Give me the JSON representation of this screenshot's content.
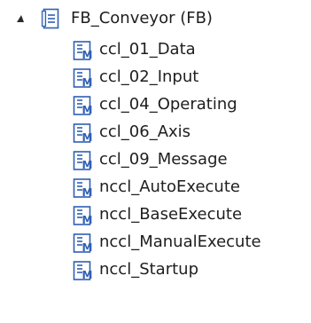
{
  "tree": {
    "root": {
      "label": "FB_Conveyor (FB)",
      "expanded": true,
      "icon": "function-block-icon"
    },
    "children": [
      {
        "label": "ccl_01_Data",
        "icon": "method-icon"
      },
      {
        "label": "ccl_02_Input",
        "icon": "method-icon"
      },
      {
        "label": "ccl_04_Operating",
        "icon": "method-icon"
      },
      {
        "label": "ccl_06_Axis",
        "icon": "method-icon"
      },
      {
        "label": "ccl_09_Message",
        "icon": "method-icon"
      },
      {
        "label": "nccl_AutoExecute",
        "icon": "method-icon"
      },
      {
        "label": "nccl_BaseExecute",
        "icon": "method-icon"
      },
      {
        "label": "nccl_ManualExecute",
        "icon": "method-icon"
      },
      {
        "label": "nccl_Startup",
        "icon": "method-icon"
      }
    ]
  },
  "colors": {
    "icon_blue": "#2f5fb3",
    "icon_light": "#dfe9f8",
    "text": "#1e1e1e"
  }
}
